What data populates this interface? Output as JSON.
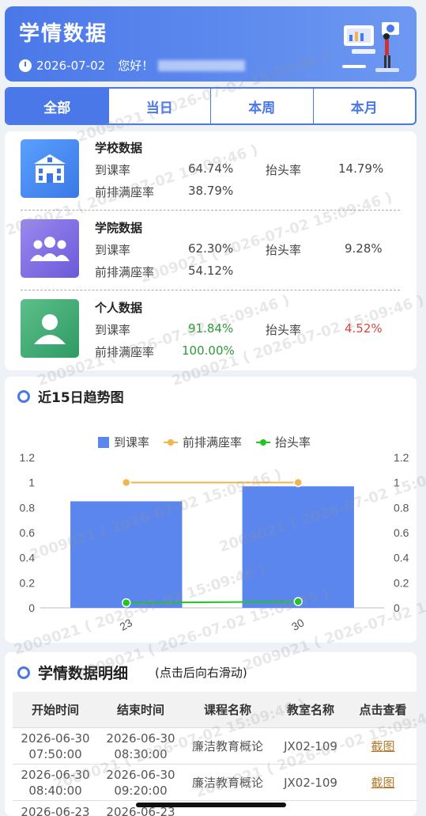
{
  "header": {
    "title": "学情数据",
    "date": "2026-07-02",
    "greeting": "您好！"
  },
  "tabs": [
    {
      "label": "全部",
      "active": true
    },
    {
      "label": "当日",
      "active": false
    },
    {
      "label": "本周",
      "active": false
    },
    {
      "label": "本月",
      "active": false
    }
  ],
  "stats": [
    {
      "name": "学校数据",
      "attend_label": "到课率",
      "attend": "64.74%",
      "head_label": "抬头率",
      "head": "14.79%",
      "front_label": "前排满座率",
      "front": "38.79%",
      "icon": "school-icon"
    },
    {
      "name": "学院数据",
      "attend_label": "到课率",
      "attend": "62.30%",
      "head_label": "抬头率",
      "head": "9.28%",
      "front_label": "前排满座率",
      "front": "54.12%",
      "icon": "group-icon"
    },
    {
      "name": "个人数据",
      "attend_label": "到课率",
      "attend": "91.84%",
      "head_label": "抬头率",
      "head": "4.52%",
      "front_label": "前排满座率",
      "front": "100.00%",
      "icon": "user-icon"
    }
  ],
  "trend": {
    "title": "近15日趋势图"
  },
  "chart_data": {
    "type": "bar",
    "categories": [
      "23",
      "30"
    ],
    "series": [
      {
        "name": "到课率",
        "type": "bar",
        "values": [
          0.85,
          0.97
        ]
      },
      {
        "name": "前排满座率",
        "type": "line",
        "values": [
          1.0,
          1.0
        ]
      },
      {
        "name": "抬头率",
        "type": "line",
        "values": [
          0.04,
          0.05
        ]
      }
    ],
    "ylim": [
      0,
      1.2
    ],
    "yticks": [
      "0",
      "0.2",
      "0.4",
      "0.6",
      "0.8",
      "1",
      "1.2"
    ],
    "colors": {
      "到课率": "#5b86ee",
      "前排满座率": "#f2b54c",
      "抬头率": "#22c322"
    },
    "legend": "top"
  },
  "detail": {
    "title": "学情数据明细",
    "hint": "(点击后向右滑动)",
    "columns": [
      "开始时间",
      "结束时间",
      "课程名称",
      "教室名称",
      "点击查看"
    ],
    "rows": [
      {
        "start_date": "2026-06-30",
        "start_time": "07:50:00",
        "end_date": "2026-06-30",
        "end_time": "08:30:00",
        "course": "廉洁教育概论",
        "room": "JX02-109",
        "action": "截图"
      },
      {
        "start_date": "2026-06-30",
        "start_time": "08:40:00",
        "end_date": "2026-06-30",
        "end_time": "09:20:00",
        "course": "廉洁教育概论",
        "room": "JX02-109",
        "action": "截图"
      },
      {
        "start_date": "2026-06-23",
        "start_time": "",
        "end_date": "2026-06-23",
        "end_time": "",
        "course": "",
        "room": "",
        "action": ""
      }
    ]
  },
  "watermark": "2009021 ( 2026-07-02 15:09:46 )"
}
